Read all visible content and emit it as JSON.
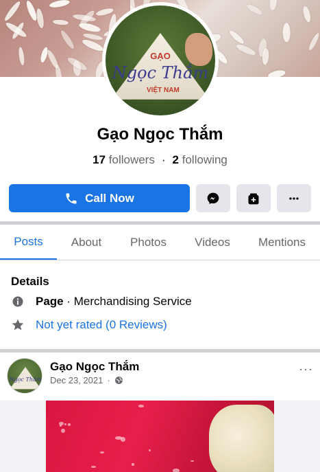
{
  "page": {
    "name": "Gạo Ngọc Thắm",
    "avatar_text": {
      "top": "GẠO",
      "middle": "Ngọc Thắm",
      "bottom": "VIỆT NAM"
    },
    "followers_count": "17",
    "followers_label": "followers",
    "separator": "·",
    "following_count": "2",
    "following_label": "following"
  },
  "actions": {
    "call_label": "Call Now",
    "messenger_icon": "messenger-icon",
    "save_icon": "save-icon",
    "more_icon": "more-icon"
  },
  "tabs": [
    {
      "label": "Posts",
      "active": true
    },
    {
      "label": "About",
      "active": false
    },
    {
      "label": "Photos",
      "active": false
    },
    {
      "label": "Videos",
      "active": false
    },
    {
      "label": "Mentions",
      "active": false
    }
  ],
  "details": {
    "title": "Details",
    "category_prefix": "Page",
    "category_sep": " · ",
    "category": "Merchandising Service",
    "rating": "Not yet rated (0 Reviews)"
  },
  "post": {
    "author": "Gạo Ngọc Thắm",
    "date": "Dec 23, 2021",
    "dot": "·",
    "privacy_icon": "globe-icon",
    "more": "···"
  },
  "colors": {
    "accent": "#1b74e4",
    "secondary_text": "#65676b",
    "button_grey": "#e4e6eb"
  }
}
